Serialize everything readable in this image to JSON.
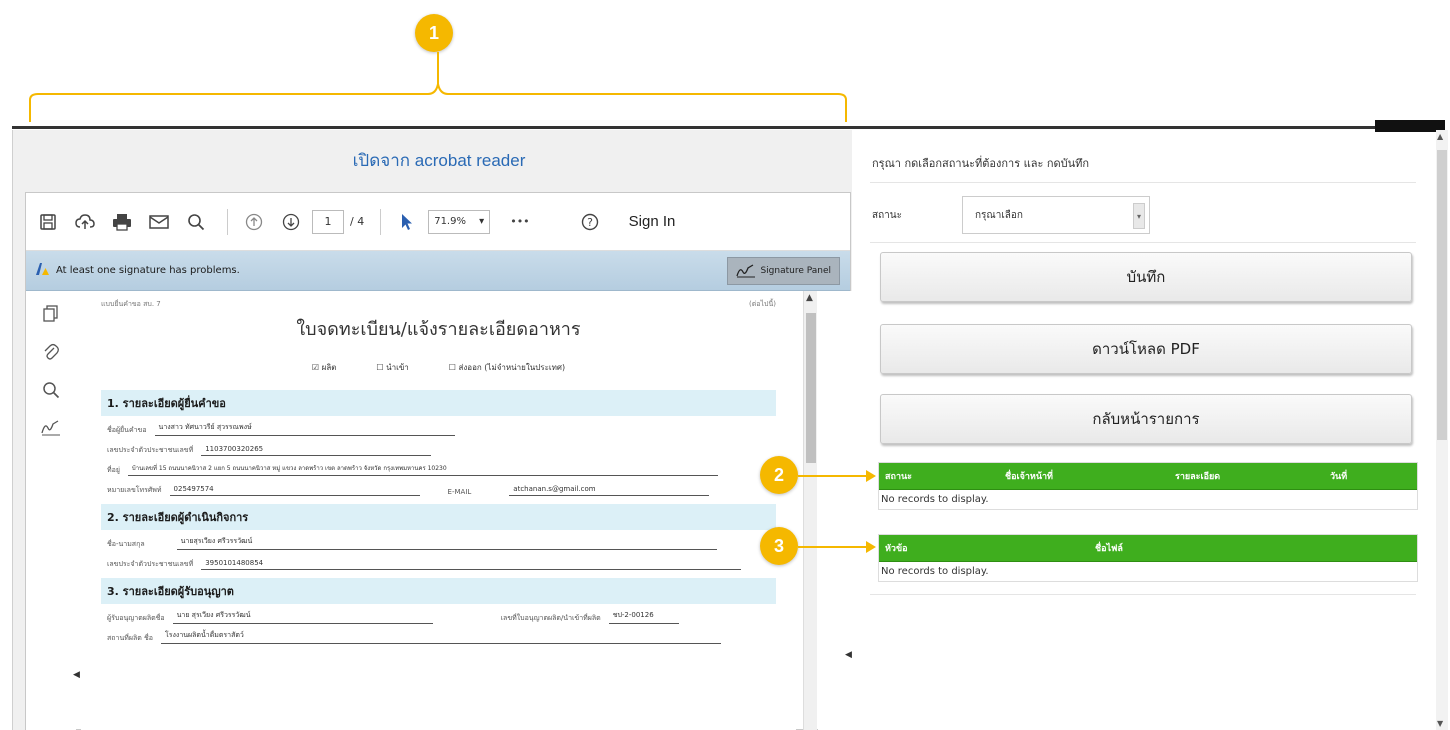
{
  "callouts": {
    "one": "1",
    "two": "2",
    "three": "3"
  },
  "left": {
    "title": "เปิดจาก acrobat reader",
    "toolbar": {
      "page_current": "1",
      "page_total": "/ 4",
      "zoom": "71.9%",
      "more": "•••",
      "sign_in": "Sign In"
    },
    "signature_bar": {
      "message": "At least one signature has problems.",
      "panel_button": "Signature Panel"
    },
    "document": {
      "form_no": "แบบยื่นคำขอ สบ. 7",
      "top_right": "(ต่อไปนี้)",
      "title": "ใบจดทะเบียน/แจ้งรายละเอียดอาหาร",
      "checks": [
        "☑ ผลิต",
        "☐ นำเข้า",
        "☐ ส่งออก (ไม่จำหน่ายในประเทศ)"
      ],
      "section1": {
        "heading": "1. รายละเอียดผู้ยื่นคำขอ",
        "name_label": "ชื่อผู้ยื่นคำขอ",
        "name_value": "นางสาว ทัศนาวรีย์ สุวรรณพงษ์",
        "id_label": "เลขประจำตัวประชาชนเลขที่",
        "id_value": "1103700320265",
        "addr_label": "ที่อยู่",
        "addr_value": "บ้านเลขที่ 15 ถนนนาคนิวาส 2 แยก 5 ถนนนาคนิวาส หมู่ แขวง ลาดพร้าว เขต ลาดพร้าว จังหวัด กรุงเทพมหานคร 10230",
        "phone_label": "หมายเลขโทรศัพท์",
        "phone_value": "025497574",
        "email_label": "E-MAIL",
        "email_value": "atchanan.s@gmail.com"
      },
      "section2": {
        "heading": "2. รายละเอียดผู้ดำเนินกิจการ",
        "name_label": "ชื่อ-นามสกุล",
        "name_value": "นายสุรเวียง ศรีวรรวัฒน์",
        "id_label": "เลขประจำตัวประชาชนเลขที่",
        "id_value": "3950101480854"
      },
      "section3": {
        "heading": "3. รายละเอียดผู้รับอนุญาต",
        "licensee_label": "ผู้รับอนุญาตผลิตชื่อ",
        "licensee_value": "นาย สุรเวียง ศรีวรรวัฒน์",
        "license_no_label": "เลขที่ใบอนุญาตผลิต/นำเข้าที่ผลิต",
        "license_no_value": "ชป-2-00126",
        "place_label": "สถานที่ผลิต ชื่อ",
        "place_value": "โรงงานผลิตน้ำดื่มตราสัตว์"
      }
    }
  },
  "right": {
    "instruction": "กรุณา กดเลือกสถานะที่ต้องการ และ กดบันทึก",
    "status_label": "สถานะ",
    "status_selected": "กรุณาเลือก",
    "buttons": {
      "save": "บันทึก",
      "download": "ดาวน์โหลด PDF",
      "back": "กลับหน้ารายการ"
    },
    "grid1": {
      "headers": [
        "สถานะ",
        "ชื่อเจ้าหน้าที่",
        "รายละเอียด",
        "วันที่"
      ],
      "empty": "No records to display."
    },
    "grid2": {
      "headers": [
        "หัวข้อ",
        "ชื่อไฟล์"
      ],
      "empty": "No records to display."
    }
  },
  "colors": {
    "callout": "#f5b800",
    "grid_header": "#3fae1e",
    "title_link": "#2a6ab5",
    "section_bg": "#dcf0f7"
  },
  "icons": [
    "save-icon",
    "upload-icon",
    "print-icon",
    "mail-icon",
    "search-icon",
    "prev-page-icon",
    "next-page-icon",
    "select-cursor-icon",
    "help-icon",
    "pages-icon",
    "attachment-icon",
    "search-side-icon",
    "sign-icon",
    "signature-warning-icon"
  ]
}
